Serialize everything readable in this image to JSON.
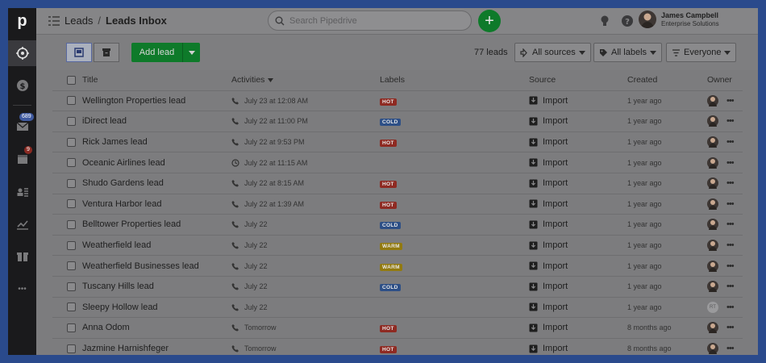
{
  "app": {
    "logo_letter": "p"
  },
  "sidebar": {
    "mail_badge": "689",
    "activities_badge": "9",
    "more_label": "•••"
  },
  "header": {
    "breadcrumb_parent": "Leads",
    "breadcrumb_sep": "/",
    "breadcrumb_current": "Leads Inbox",
    "search_placeholder": "Search Pipedrive",
    "add_label": "+",
    "user_name": "James Campbell",
    "user_company": "Enterprise Solutions"
  },
  "toolbar": {
    "add_lead_label": "Add lead",
    "count": "77 leads",
    "filter_sources": "All sources",
    "filter_labels": "All labels",
    "filter_owner": "Everyone"
  },
  "table": {
    "headers": {
      "title": "Title",
      "activities": "Activities",
      "labels": "Labels",
      "source": "Source",
      "created": "Created",
      "owner": "Owner"
    },
    "rows": [
      {
        "title": "Wellington Properties lead",
        "activity": "July 23 at 12:08 AM",
        "activity_icon": "phone",
        "label": "HOT",
        "source": "Import",
        "created": "1 year ago",
        "owner": "JC"
      },
      {
        "title": "iDirect lead",
        "activity": "July 22 at 11:00 PM",
        "activity_icon": "phone",
        "label": "COLD",
        "source": "Import",
        "created": "1 year ago",
        "owner": "JC"
      },
      {
        "title": "Rick James lead",
        "activity": "July 22 at 9:53 PM",
        "activity_icon": "phone",
        "label": "HOT",
        "source": "Import",
        "created": "1 year ago",
        "owner": "JC"
      },
      {
        "title": "Oceanic Airlines lead",
        "activity": "July 22 at 11:15 AM",
        "activity_icon": "clock",
        "label": "",
        "source": "Import",
        "created": "1 year ago",
        "owner": "JC"
      },
      {
        "title": "Shudo Gardens lead",
        "activity": "July 22 at 8:15 AM",
        "activity_icon": "phone",
        "label": "HOT",
        "source": "Import",
        "created": "1 year ago",
        "owner": "JC"
      },
      {
        "title": "Ventura Harbor lead",
        "activity": "July 22 at 1:39 AM",
        "activity_icon": "phone",
        "label": "HOT",
        "source": "Import",
        "created": "1 year ago",
        "owner": "JC"
      },
      {
        "title": "Belltower Properties lead",
        "activity": "July 22",
        "activity_icon": "phone",
        "label": "COLD",
        "source": "Import",
        "created": "1 year ago",
        "owner": "JC"
      },
      {
        "title": "Weatherfield lead",
        "activity": "July 22",
        "activity_icon": "phone",
        "label": "WARM",
        "source": "Import",
        "created": "1 year ago",
        "owner": "JC"
      },
      {
        "title": "Weatherfield Businesses lead",
        "activity": "July 22",
        "activity_icon": "phone",
        "label": "WARM",
        "source": "Import",
        "created": "1 year ago",
        "owner": "JC"
      },
      {
        "title": "Tuscany Hills lead",
        "activity": "July 22",
        "activity_icon": "phone",
        "label": "COLD",
        "source": "Import",
        "created": "1 year ago",
        "owner": "JC"
      },
      {
        "title": "Sleepy Hollow lead",
        "activity": "July 22",
        "activity_icon": "phone",
        "label": "",
        "source": "Import",
        "created": "1 year ago",
        "owner": "RT"
      },
      {
        "title": "Anna Odom",
        "activity": "Tomorrow",
        "activity_icon": "phone",
        "label": "HOT",
        "source": "Import",
        "created": "8 months ago",
        "owner": "JC"
      },
      {
        "title": "Jazmine Harnishfeger",
        "activity": "Tomorrow",
        "activity_icon": "phone",
        "label": "HOT",
        "source": "Import",
        "created": "8 months ago",
        "owner": "JC"
      }
    ]
  },
  "colors": {
    "hot": "#8e2a22",
    "cold": "#2d4f86",
    "warm": "#927a10",
    "accent_green": "#0e7a2a"
  }
}
